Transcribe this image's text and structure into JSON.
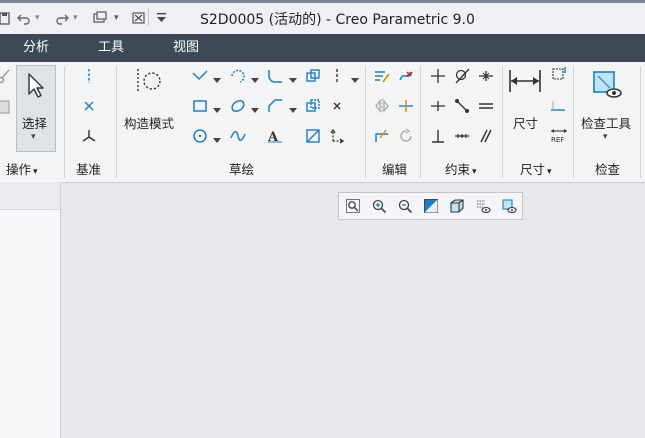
{
  "window": {
    "title": "S2D0005 (活动的) - Creo Parametric 9.0"
  },
  "quick_access": {
    "items": [
      "save-icon",
      "undo-icon",
      "redo-icon",
      "regenerate-icon",
      "close-window-icon",
      "customize-icon"
    ]
  },
  "tabs": [
    {
      "label": "分析"
    },
    {
      "label": "工具"
    },
    {
      "label": "视图"
    }
  ],
  "ribbon": {
    "operations": {
      "select_label": "选择",
      "group_label": "操作"
    },
    "datum": {
      "group_label": "基准"
    },
    "sketch": {
      "construction_mode_label": "构造模式",
      "group_label": "草绘"
    },
    "edit": {
      "group_label": "编辑"
    },
    "constrain": {
      "group_label": "约束"
    },
    "dimension": {
      "dimension_label": "尺寸",
      "group_label": "尺寸"
    },
    "inspect": {
      "inspect_tool_label": "检查工具",
      "group_label": "检查"
    }
  },
  "colors": {
    "tab_bar": "#3d4a55",
    "icon_blue": "#1a7fc6",
    "ribbon_bg": "#f3f4f6",
    "workspace_bg": "#e6e8ec"
  }
}
